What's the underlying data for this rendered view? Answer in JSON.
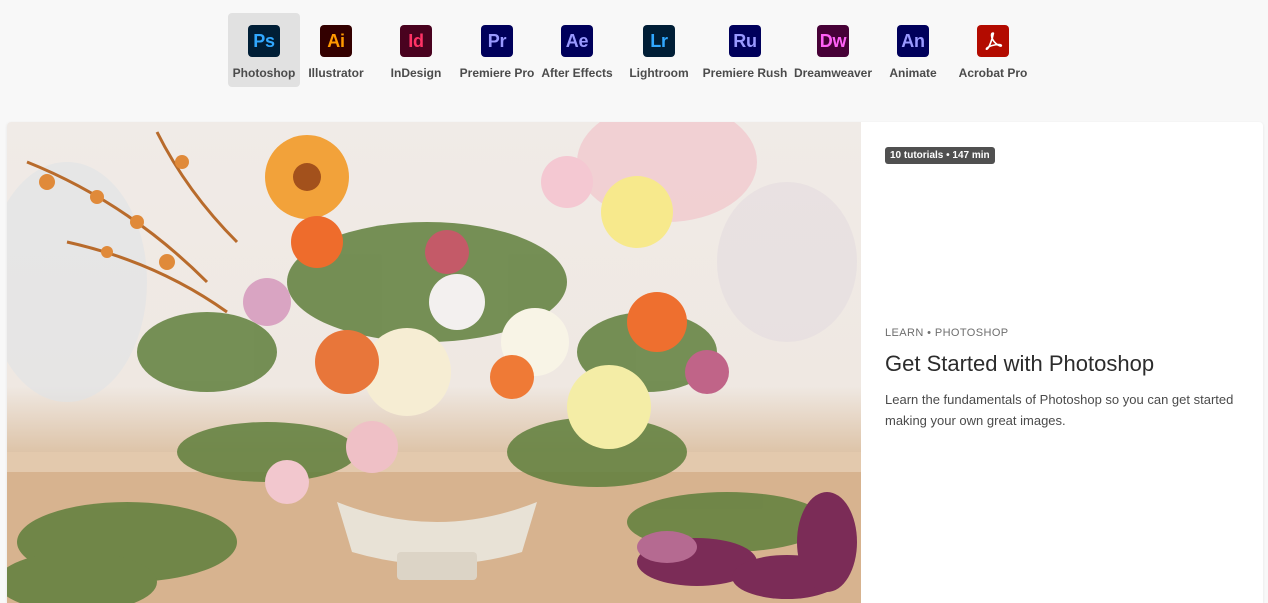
{
  "apps": [
    {
      "abbr": "Ps",
      "name": "Photoshop",
      "bg": "#001e36",
      "fg": "#31a8ff",
      "selected": true
    },
    {
      "abbr": "Ai",
      "name": "Illustrator",
      "bg": "#330000",
      "fg": "#ff9a00",
      "selected": false
    },
    {
      "abbr": "Id",
      "name": "InDesign",
      "bg": "#49021f",
      "fg": "#ff3366",
      "selected": false
    },
    {
      "abbr": "Pr",
      "name": "Premiere Pro",
      "bg": "#00005b",
      "fg": "#9999ff",
      "selected": false
    },
    {
      "abbr": "Ae",
      "name": "After Effects",
      "bg": "#00005b",
      "fg": "#9999ff",
      "selected": false
    },
    {
      "abbr": "Lr",
      "name": "Lightroom",
      "bg": "#001e36",
      "fg": "#31a8ff",
      "selected": false
    },
    {
      "abbr": "Ru",
      "name": "Premiere Rush",
      "bg": "#00005b",
      "fg": "#9999ff",
      "selected": false
    },
    {
      "abbr": "Dw",
      "name": "Dreamweaver",
      "bg": "#470137",
      "fg": "#ff61f6",
      "selected": false
    },
    {
      "abbr": "An",
      "name": "Animate",
      "bg": "#00005b",
      "fg": "#9999ff",
      "selected": false
    },
    {
      "abbr": "",
      "name": "Acrobat Pro",
      "bg": "#b30b00",
      "fg": "#ffffff",
      "selected": false
    }
  ],
  "featured": {
    "badge": "10 tutorials • 147 min",
    "eyebrow": "LEARN • PHOTOSHOP",
    "title": "Get Started with Photoshop",
    "description": "Learn the fundamentals of Photoshop so you can get started making your own great images.",
    "image_icon": "flower-arrangement-photo"
  }
}
